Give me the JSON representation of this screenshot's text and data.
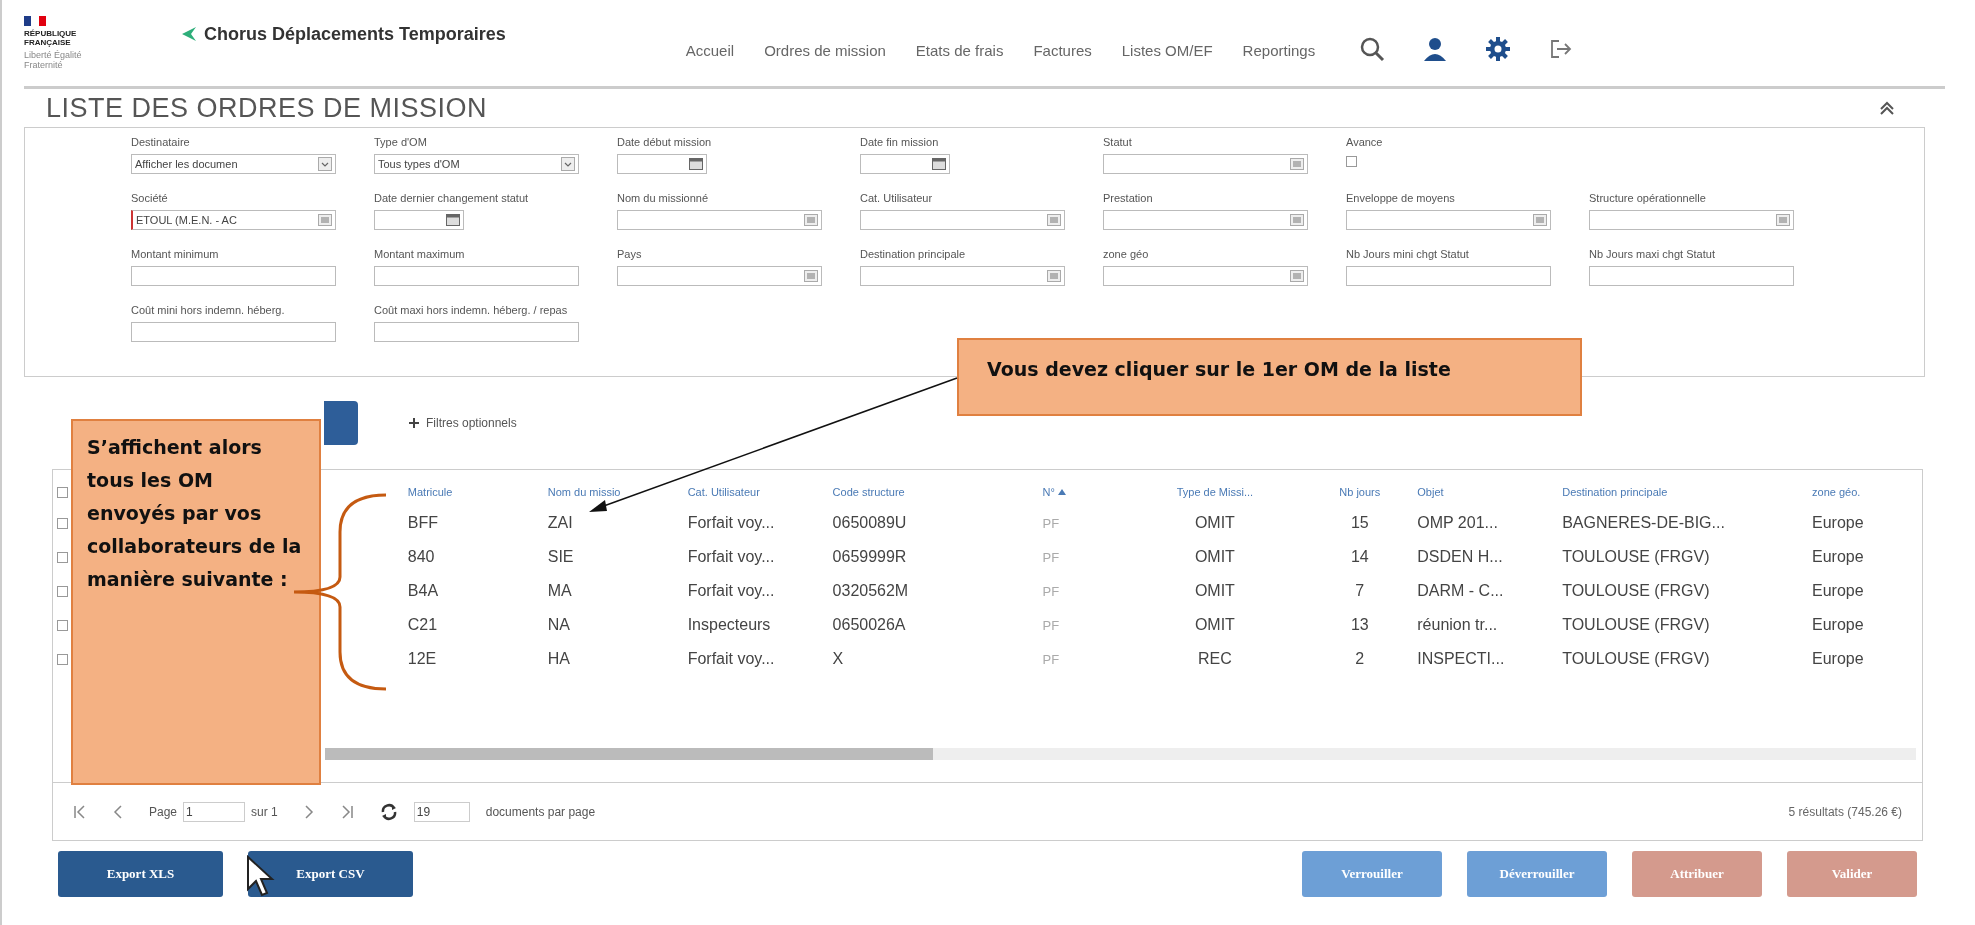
{
  "header": {
    "republic": "RÉPUBLIQUE FRANÇAISE",
    "motto": "Liberté Égalité Fraternité",
    "app_title": "Chorus Déplacements Temporaires",
    "nav": [
      {
        "label": "Accueil"
      },
      {
        "label": "Ordres de mission"
      },
      {
        "label": "Etats de frais"
      },
      {
        "label": "Factures"
      },
      {
        "label": "Listes OM/EF"
      },
      {
        "label": "Reportings"
      }
    ]
  },
  "page_title": "LISTE DES ORDRES DE MISSION",
  "filters": [
    [
      {
        "label": "Destinataire",
        "kind": "select",
        "value": "Afficher les documen"
      },
      {
        "label": "Type d'OM",
        "kind": "select",
        "value": "Tous types d'OM"
      },
      {
        "label": "Date début mission",
        "kind": "date"
      },
      {
        "label": "Date fin mission",
        "kind": "date"
      },
      {
        "label": "Statut",
        "kind": "combo"
      },
      {
        "label": "Avance",
        "kind": "checkbox",
        "checked": false
      }
    ],
    [
      {
        "label": "Société",
        "kind": "combo",
        "value": "ETOUL (M.E.N. - AC",
        "required": true
      },
      {
        "label": "Date dernier changement statut",
        "kind": "date"
      },
      {
        "label": "Nom du missionné",
        "kind": "combo"
      },
      {
        "label": "Cat. Utilisateur",
        "kind": "combo"
      },
      {
        "label": "Prestation",
        "kind": "combo"
      },
      {
        "label": "Enveloppe de moyens",
        "kind": "combo"
      },
      {
        "label": "Structure opérationnelle",
        "kind": "combo"
      }
    ],
    [
      {
        "label": "Montant minimum",
        "kind": "text"
      },
      {
        "label": "Montant maximum",
        "kind": "text"
      },
      {
        "label": "Pays",
        "kind": "combo"
      },
      {
        "label": "Destination principale",
        "kind": "combo"
      },
      {
        "label": "zone géo",
        "kind": "combo"
      },
      {
        "label": "Nb Jours mini chgt Statut",
        "kind": "text"
      },
      {
        "label": "Nb Jours maxi chgt Statut",
        "kind": "text"
      }
    ],
    [
      {
        "label": "Coût mini hors indemn. héberg.",
        "kind": "text"
      },
      {
        "label": "Coût maxi hors indemn. héberg. / repas",
        "kind": "text"
      }
    ]
  ],
  "optional_filters": "Filtres optionnels",
  "table": {
    "all_checked": false,
    "columns": [
      {
        "label": "Matricule"
      },
      {
        "label": "Nom du missio"
      },
      {
        "label": "Cat. Utilisateur"
      },
      {
        "label": "Code structure"
      },
      {
        "label": "N°",
        "sorted": true
      },
      {
        "label": "Type de Missi..."
      },
      {
        "label": "Nb jours"
      },
      {
        "label": "Objet"
      },
      {
        "label": "Destination principale"
      },
      {
        "label": "zone géo."
      }
    ],
    "rows": [
      {
        "checked": false,
        "cells": [
          "BFF",
          "ZAI",
          "Forfait voy...",
          "0650089U",
          "PF",
          "OMIT",
          "15",
          "OMP 201...",
          "BAGNERES-DE-BIG...",
          "Europe"
        ]
      },
      {
        "checked": false,
        "cells": [
          "840",
          "SIE",
          "Forfait voy...",
          "0659999R",
          "PF",
          "OMIT",
          "14",
          "DSDEN H...",
          "TOULOUSE (FRGV)",
          "Europe"
        ]
      },
      {
        "checked": false,
        "cells": [
          "B4A",
          "MA",
          "Forfait voy...",
          "0320562M",
          "PF",
          "OMIT",
          "7",
          "DARM - C...",
          "TOULOUSE (FRGV)",
          "Europe"
        ]
      },
      {
        "checked": false,
        "cells": [
          "C21",
          "NA",
          "Inspecteurs",
          "0650026A",
          "PF",
          "OMIT",
          "13",
          "réunion tr...",
          "TOULOUSE (FRGV)",
          "Europe"
        ]
      },
      {
        "checked": false,
        "cells": [
          "12E",
          "HA",
          "Forfait voy...",
          "X",
          "PF",
          "REC",
          "2",
          "INSPECTI...",
          "TOULOUSE (FRGV)",
          "Europe"
        ]
      }
    ]
  },
  "pagination": {
    "page_label": "Page",
    "page": "1",
    "of": "sur 1",
    "per_page": "19",
    "per_page_label": "documents par page",
    "results": "5 résultats (745.26 €)"
  },
  "buttons": [
    {
      "label": "Export XLS",
      "kind": "primary"
    },
    {
      "label": "Export CSV",
      "kind": "primary"
    },
    {
      "label": "Verrouiller",
      "kind": "light"
    },
    {
      "label": "Déverrouiller",
      "kind": "light"
    },
    {
      "label": "Attribuer",
      "kind": "muted"
    },
    {
      "label": "Valider",
      "kind": "muted"
    }
  ],
  "annotations": [
    {
      "kind": "top",
      "text": "Vous devez cliquer sur le 1er OM de la liste"
    },
    {
      "kind": "left",
      "text": "S’affichent alors tous les OM envoyés par vos collaborateurs de la manière suivante :"
    }
  ]
}
